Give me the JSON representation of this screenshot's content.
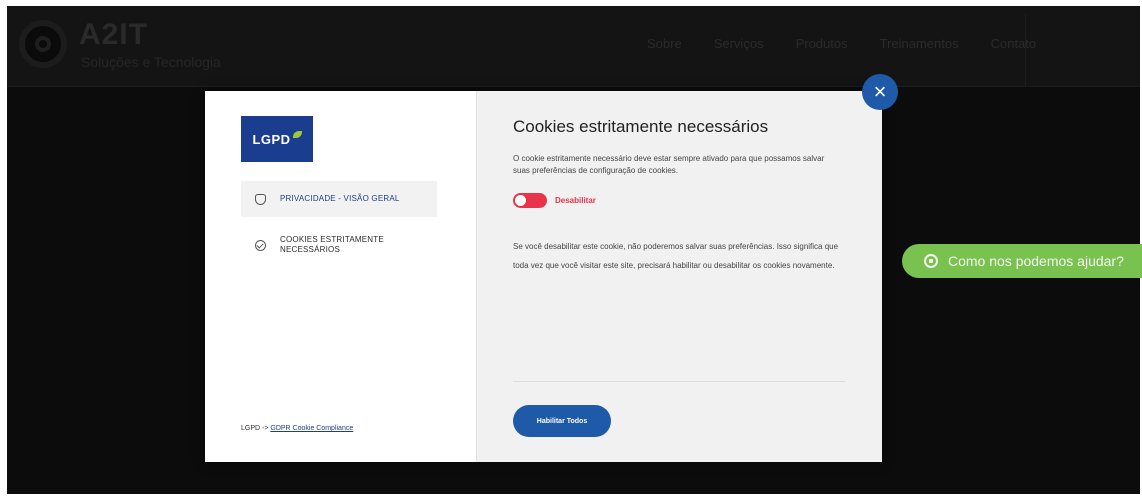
{
  "site": {
    "brand": "A2IT",
    "brand_sub": "Soluções e Tecnologia",
    "nav": [
      "Sobre",
      "Serviços",
      "Produtos",
      "Treinamentos",
      "Contato"
    ]
  },
  "whatsapp": {
    "label": "Como nos podemos ajudar?"
  },
  "modal": {
    "logo_text": "LGPD",
    "sidebar": [
      {
        "label": "PRIVACIDADE - VISÃO GERAL"
      },
      {
        "label": "COOKIES ESTRITAMENTE NECESSÁRIOS"
      }
    ],
    "footer": {
      "prefix": "LGPD -> ",
      "link": "GDPR Cookie Compliance"
    },
    "title": "Cookies estritamente necessários",
    "description": "O cookie estritamente necessário deve estar sempre ativado para que possamos salvar suas preferências de configuração de cookies.",
    "toggle_label": "Desabilitar",
    "info": "Se você desabilitar este cookie, não poderemos salvar suas preferências. Isso significa que toda vez que você visitar este site, precisará habilitar ou desabilitar os cookies novamente.",
    "enable_all": "Habilitar Todos",
    "close": "×"
  },
  "colors": {
    "accent": "#1f5aa8",
    "toggle": "#e8334a",
    "whatsapp": "#79c24f",
    "lgpd": "#1b3d8f"
  }
}
